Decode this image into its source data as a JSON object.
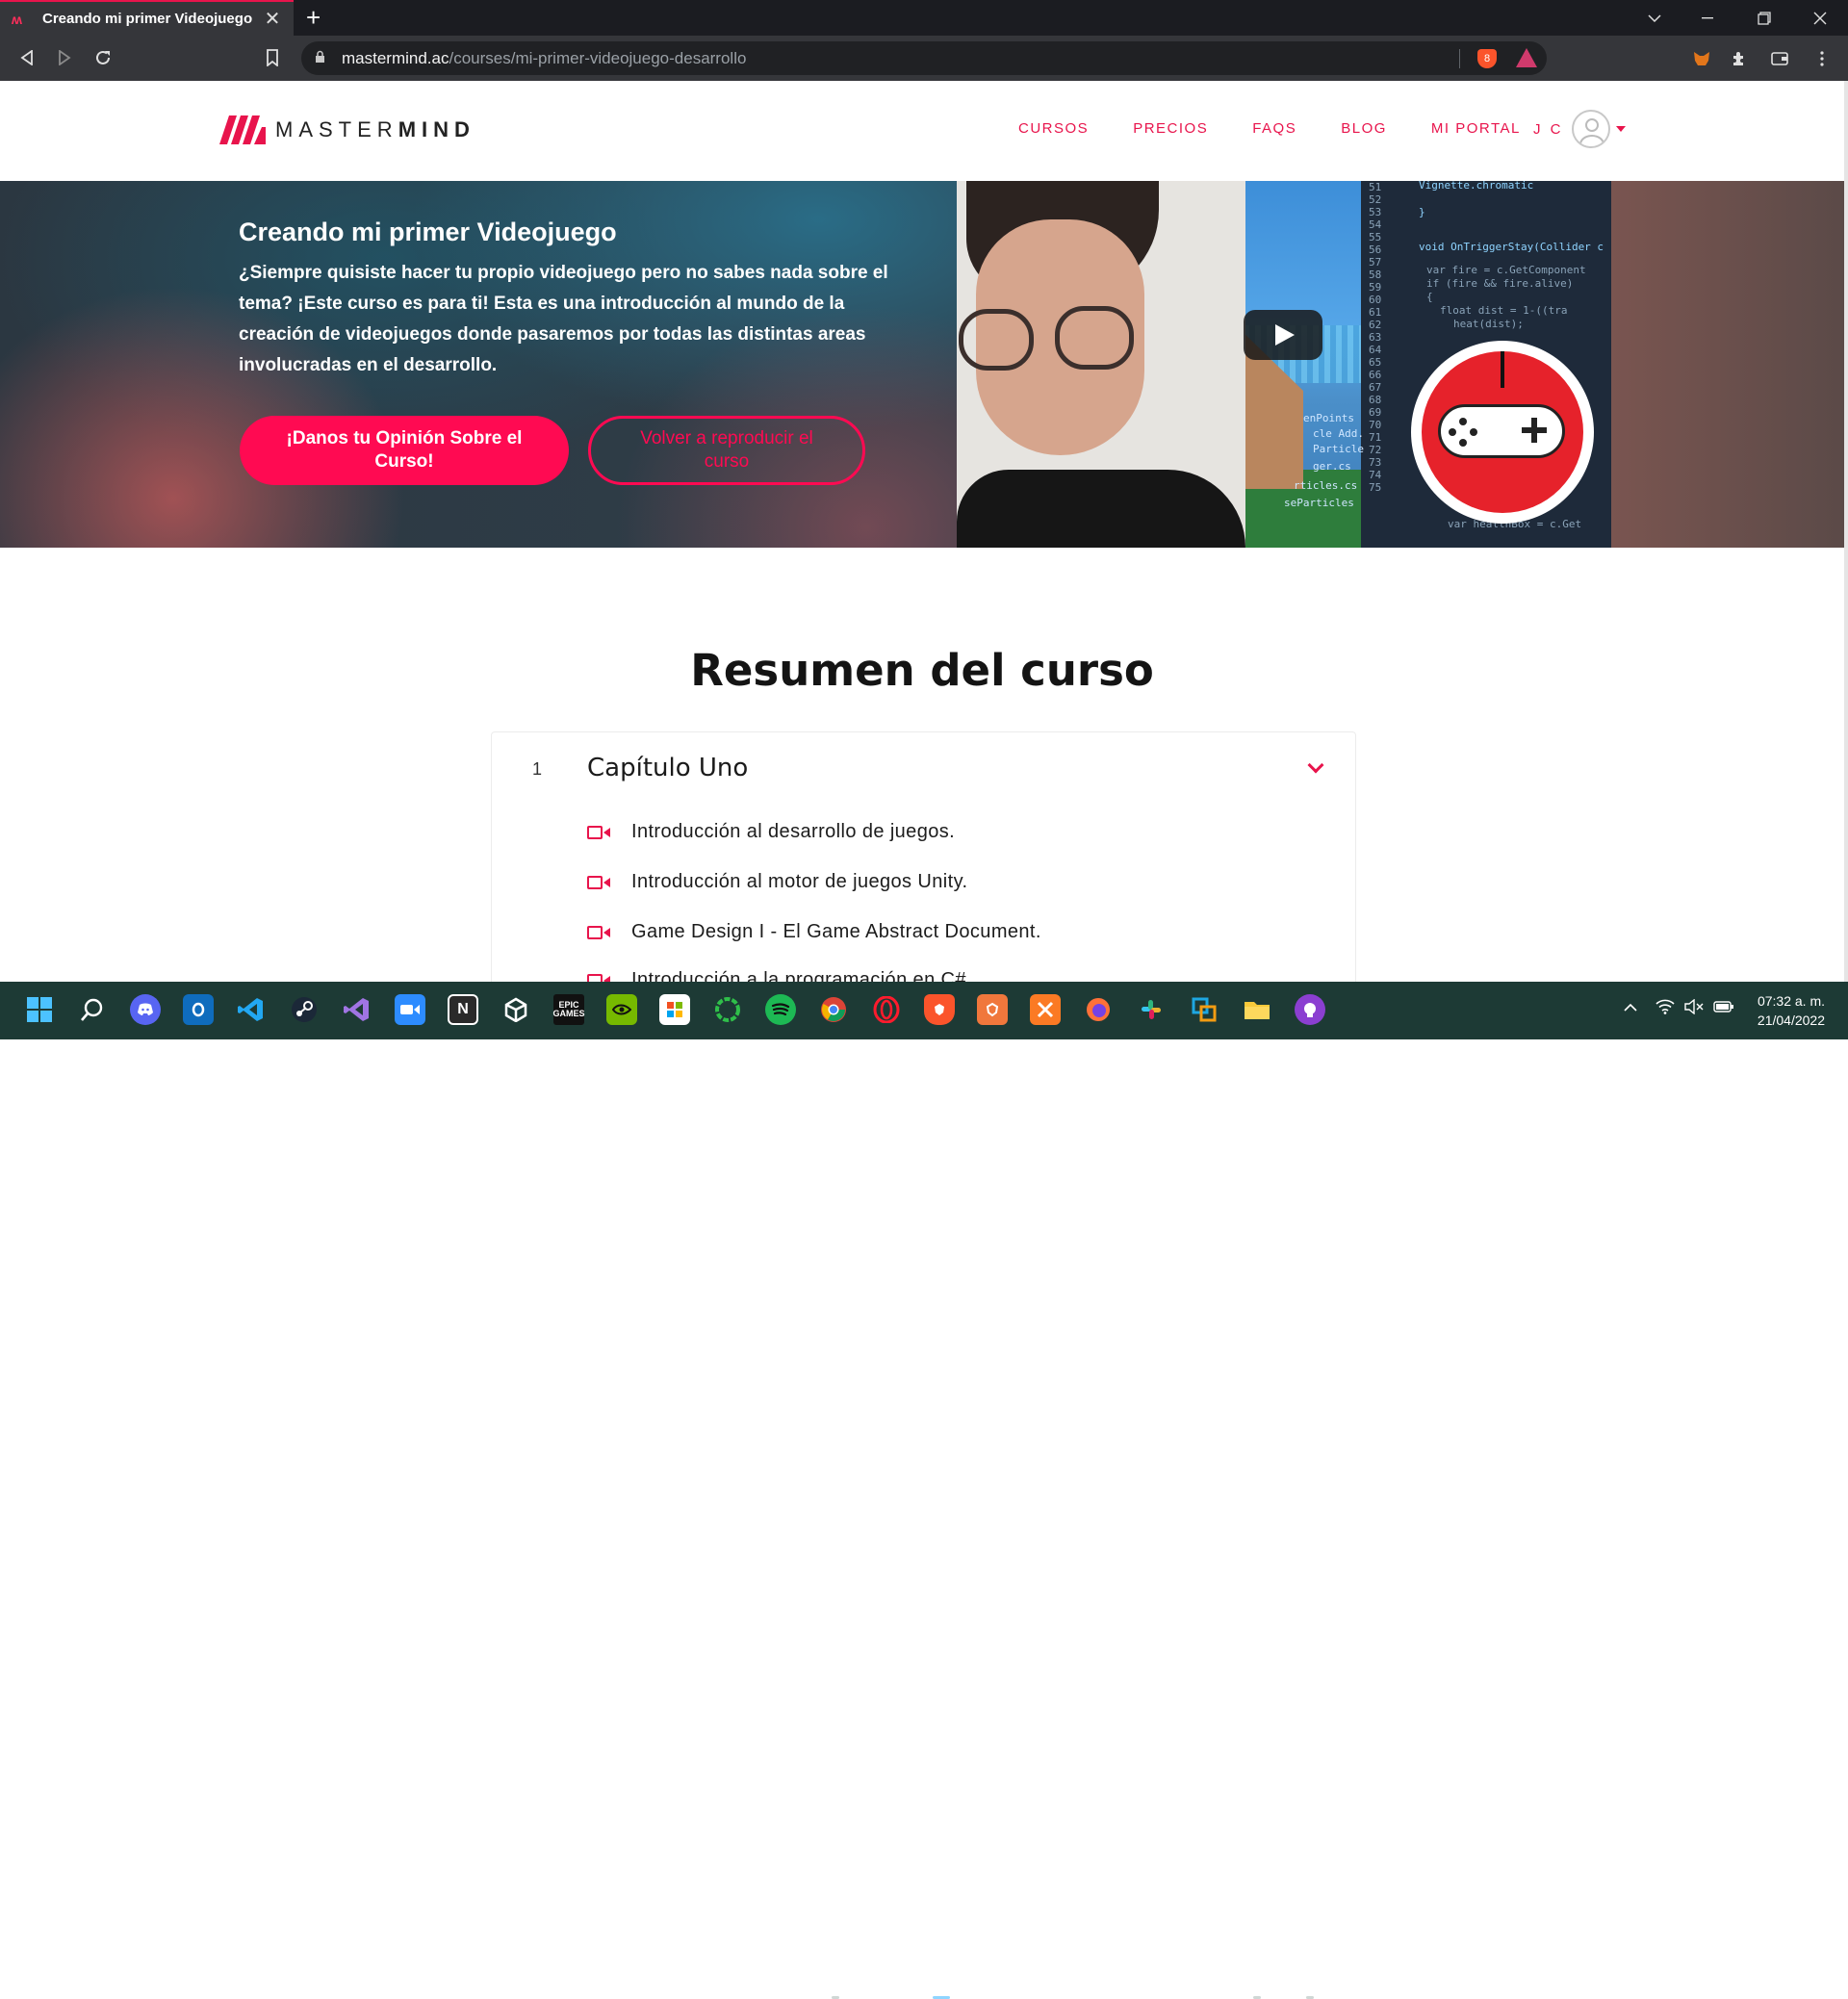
{
  "browser": {
    "tab_title": "Creando mi primer Videojuego",
    "tab_close": "✕",
    "new_tab": "+",
    "url_host": "mastermind.ac",
    "url_path": "/courses/mi-primer-videojuego-desarrollo",
    "brave_badge": "8"
  },
  "site": {
    "logo_text_light": "MASTER",
    "logo_text_bold": "MIND",
    "nav": [
      "CURSOS",
      "PRECIOS",
      "FAQS",
      "BLOG",
      "MI PORTAL"
    ],
    "user_initials": "J C"
  },
  "hero": {
    "title": "Creando mi primer Videojuego",
    "description": "¿Siempre quisiste hacer tu propio videojuego pero no sabes nada sobre el tema? ¡Este curso es para ti! Esta es una introducción al mundo de la creación de videojuegos donde pasaremos por todas las distintas areas involucradas en el desarrollo.",
    "primary_button": "¡Danos tu Opinión Sobre el Curso!",
    "secondary_button": "Volver a reproducir el curso",
    "video_code": {
      "line_numbers": [
        "51",
        "52",
        "53",
        "54",
        "55",
        "56",
        "57",
        "58",
        "59",
        "60",
        "61",
        "62",
        "63",
        "64",
        "65",
        "66",
        "67",
        "68",
        "69",
        "70",
        "71",
        "72",
        "73",
        "74",
        "75"
      ],
      "code_snippets": [
        "Vignette.chromatic",
        "}",
        "void OnTriggerStay(Collider c",
        "var fire = c.GetComponent",
        "if (fire && fire.alive)",
        "{",
        "float dist = 1-((tra",
        "heat(dist);",
        "var healthBox = c.Get"
      ],
      "file_labels": [
        "enPoints",
        "cle Add.",
        "Particle",
        "ger.cs",
        "rticles.cs",
        "seParticles"
      ]
    }
  },
  "summary": {
    "title": "Resumen del curso",
    "chapter_number": "1",
    "chapter_title": "Capítulo Uno",
    "lessons": [
      "Introducción al desarrollo de juegos.",
      "Introducción al motor de juegos Unity.",
      "Game Design I - El Game Abstract Document.",
      "Introducción a la programación en C#"
    ]
  },
  "taskbar": {
    "apps": [
      "start",
      "search",
      "discord",
      "outlook",
      "vscode",
      "steam",
      "visual-studio",
      "zoom",
      "notion",
      "unity",
      "epic-games",
      "nvidia",
      "store",
      "xbox",
      "spotify",
      "chrome",
      "opera",
      "brave",
      "brave-beta",
      "xampp",
      "firefox",
      "slack",
      "vmware",
      "file-explorer",
      "github-desktop"
    ],
    "epic_label": "EPIC\nGAMES",
    "notion_label": "N",
    "time": "07:32 a. m.",
    "date": "21/04/2022"
  },
  "colors": {
    "accent": "#e8144c",
    "button": "#ff0a52",
    "taskbar": "#1d3a35"
  }
}
